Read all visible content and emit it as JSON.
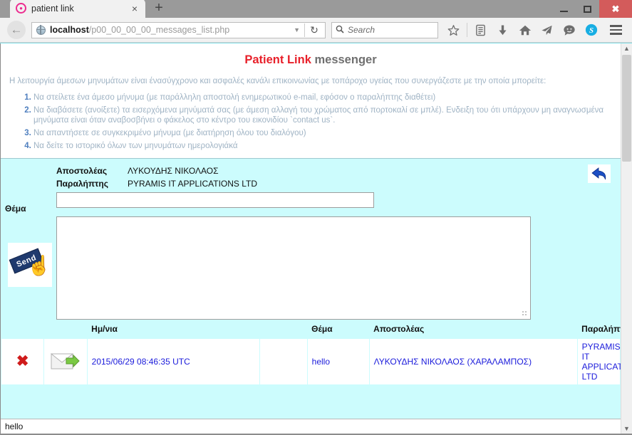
{
  "browser": {
    "tab": {
      "title": "patient link",
      "favicon": "patient-link-favicon",
      "close": "×"
    },
    "new_tab_label": "+",
    "window_controls": {
      "minimize": "minimize",
      "maximize": "maximize",
      "close": "✖"
    },
    "nav": {
      "back": "←",
      "url_host": "localhost",
      "url_path": "/p00_00_00_00_messages_list.php",
      "url_caret": "▼",
      "reload": "↻",
      "search_placeholder": "Search",
      "search_icon": "⌕",
      "icons": [
        "bookmark-star-icon",
        "reader-list-icon",
        "download-icon",
        "home-icon",
        "send-paperplane-icon",
        "chat-bubble-icon",
        "skype-icon"
      ],
      "menu": "hamburger-menu"
    }
  },
  "page": {
    "header": {
      "brand": "Patient Link",
      "suffix": "messenger"
    },
    "lead": "Η λειτουργία άμεσων μηνυμάτων είναι ένασύγχρονο και ασφαλές κανάλι επικοινωνίας με τοπάροχο υγείας που συνεργάζεστε με την οποία μπορείτε:",
    "steps": [
      "Να στείλετε ένα άμεσο μήνυμα (με παράλληλη αποστολή ενημερωτικού e-mail, εφόσον ο παραλήπτης διαθέτει)",
      "Να διαβάσετε (ανοίξετε) τα εισερχόμενα μηνύματά σας (με άμεση αλλαγή του χρώματος από πορτοκαλί σε μπλέ). Ενδειξη του ότι υπάρχουν μη αναγνωσμένα μηνύματα είναι όταν αναβοσβήνει ο φάκελος στο κέντρο του εικονιδίου `contact us`.",
      "Να απαντήσετε σε συγκεκριμένο μήνυμα (με διατήρηση όλου του διαλόγου)",
      "Να δείτε το ιστορικό όλων των μηνυμάτων ημερολογιάκά"
    ],
    "compose": {
      "sender_label": "Αποστολέας",
      "sender_value": "ΛΥΚΟΥΔΗΣ ΝΙΚΟΛΑΟΣ",
      "recipient_label": "Παραλήπτης",
      "recipient_value": "PYRAMIS IT APPLICATIONS LTD",
      "subject_label": "Θέμα",
      "subject_value": "",
      "body_value": "",
      "send_button_label": "Send",
      "back_button": "back-arrow"
    },
    "table": {
      "columns": [
        "",
        "",
        "Ημ/νια",
        "",
        "Θέμα",
        "Αποστολέας",
        "Παραλήπτης"
      ],
      "rows": [
        {
          "delete": "✖",
          "status_icon": "sent-envelope-icon",
          "date": "2015/06/29 08:46:35 UTC",
          "blank": "",
          "subject": "hello",
          "sender": "ΛΥΚΟΥΔΗΣ ΝΙΚΟΛΑΟΣ (ΧΑΡΑΛΑΜΠΟΣ)",
          "recipient": "PYRAMIS IT APPLICATIONS LTD"
        }
      ]
    },
    "status_text": "hello"
  }
}
